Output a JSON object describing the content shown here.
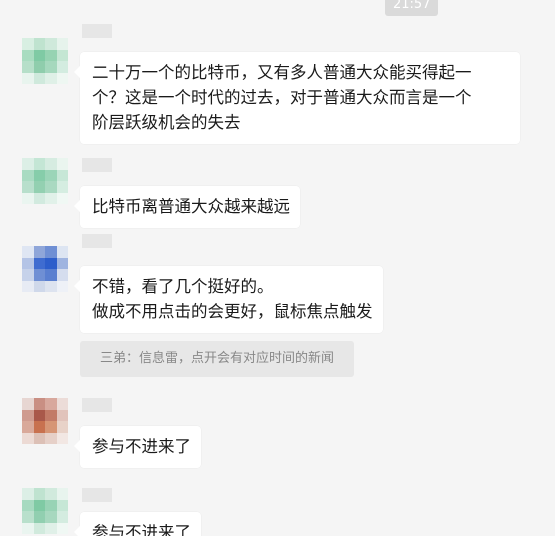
{
  "timestamp": "21:57",
  "messages": [
    {
      "text": "二十万一个的比特币，又有多人普通大众能买得起一\n个？这是一个时代的过去，对于普通大众而言是一个\n阶层跃级机会的失去"
    },
    {
      "text": "比特币离普通大众越来越远"
    },
    {
      "text": "不错，看了几个挺好的。\n做成不用点击的会更好，鼠标焦点触发",
      "quote": "三弟：信息雷，点开会有对应时间的新闻"
    },
    {
      "text": "参与不进来了"
    },
    {
      "text": "参与不进来了"
    }
  ],
  "colors": {
    "background": "#f5f5f5",
    "bubble": "#ffffff",
    "quote_bg": "#e7e7e7",
    "quote_text": "#888888",
    "time_chip": "#dadada"
  }
}
